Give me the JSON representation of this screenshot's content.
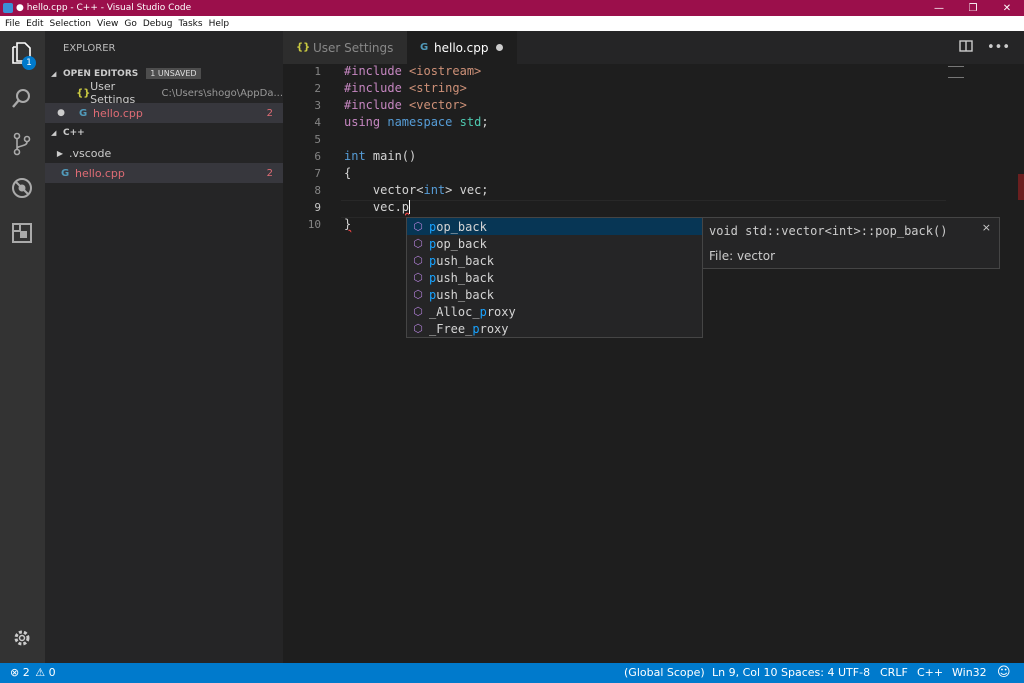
{
  "window": {
    "title": "● hello.cpp - C++ - Visual Studio Code",
    "min": "—",
    "max": "❐",
    "close": "✕"
  },
  "menu": [
    "File",
    "Edit",
    "Selection",
    "View",
    "Go",
    "Debug",
    "Tasks",
    "Help"
  ],
  "activity": {
    "explorer_badge": "1"
  },
  "sidebar": {
    "title": "EXPLORER",
    "open_editors_label": "OPEN EDITORS",
    "unsaved_badge": "1 UNSAVED",
    "open_editors": [
      {
        "name": "User Settings",
        "path": "C:\\Users\\shogo\\AppDa...",
        "icon": "{}"
      },
      {
        "name": "hello.cpp",
        "count": "2",
        "icon": "G"
      }
    ],
    "folder_label": "C++",
    "folder_items": [
      {
        "name": ".vscode"
      },
      {
        "name": "hello.cpp",
        "count": "2",
        "icon": "G"
      }
    ]
  },
  "tabs": [
    {
      "label": "User Settings",
      "icon": "{}"
    },
    {
      "label": "hello.cpp",
      "icon": "G"
    }
  ],
  "editor": {
    "line_numbers": [
      "1",
      "2",
      "3",
      "4",
      "5",
      "6",
      "7",
      "8",
      "9",
      "10"
    ]
  },
  "suggest": {
    "items": [
      {
        "prefix": "p",
        "rest": "op_back"
      },
      {
        "prefix": "p",
        "rest": "op_back"
      },
      {
        "prefix": "p",
        "rest": "ush_back"
      },
      {
        "prefix": "p",
        "rest": "ush_back"
      },
      {
        "prefix": "p",
        "rest": "ush_back"
      },
      {
        "pre": "_Alloc_",
        "prefix": "p",
        "rest": "roxy"
      },
      {
        "pre": "_Free_",
        "prefix": "p",
        "rest": "roxy"
      }
    ],
    "detail_signature": "void std::vector<int>::pop_back()",
    "detail_file": "File: vector",
    "close": "×"
  },
  "status": {
    "errors": "2",
    "warnings": "0",
    "scope": "(Global Scope)",
    "position": "Ln 9, Col 10",
    "spaces": "Spaces: 4",
    "encoding": "UTF-8",
    "eol": "CRLF",
    "language": "C++",
    "platform": "Win32"
  }
}
